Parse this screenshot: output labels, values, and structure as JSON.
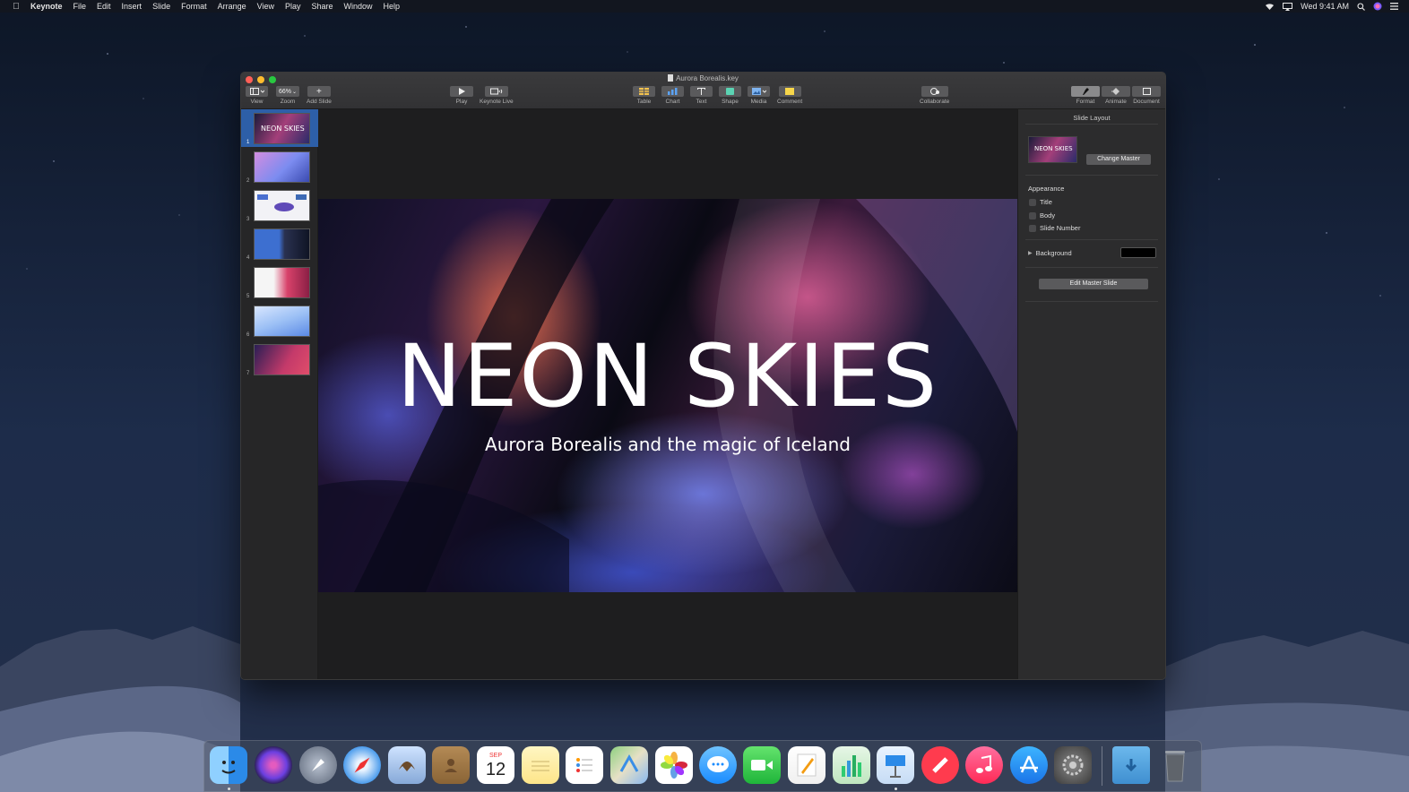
{
  "menubar": {
    "app": "Keynote",
    "items": [
      "File",
      "Edit",
      "Insert",
      "Slide",
      "Format",
      "Arrange",
      "View",
      "Play",
      "Share",
      "Window",
      "Help"
    ],
    "clock": "Wed 9:41 AM"
  },
  "window": {
    "title": "Aurora Borealis.key"
  },
  "toolbar": {
    "view_label": "View",
    "zoom_value": "66%",
    "zoom_label": "Zoom",
    "add_slide_label": "Add Slide",
    "play_label": "Play",
    "keynote_live_label": "Keynote Live",
    "table_label": "Table",
    "chart_label": "Chart",
    "text_label": "Text",
    "shape_label": "Shape",
    "media_label": "Media",
    "comment_label": "Comment",
    "collaborate_label": "Collaborate",
    "format_label": "Format",
    "animate_label": "Animate",
    "document_label": "Document"
  },
  "navigator": {
    "slides": [
      {
        "num": "1",
        "thumb_text": "NEON SKIES"
      },
      {
        "num": "2"
      },
      {
        "num": "3"
      },
      {
        "num": "4"
      },
      {
        "num": "5"
      },
      {
        "num": "6"
      },
      {
        "num": "7"
      }
    ],
    "selected": 0
  },
  "slide": {
    "title": "NEON SKIES",
    "subtitle": "Aurora Borealis and the magic of Iceland"
  },
  "inspector": {
    "header": "Slide Layout",
    "master_thumb_text": "NEON SKIES",
    "change_master": "Change Master",
    "appearance": "Appearance",
    "checkboxes": [
      "Title",
      "Body",
      "Slide Number"
    ],
    "background": "Background",
    "background_color": "#000000",
    "edit_master": "Edit Master Slide"
  },
  "dock": {
    "apps": [
      "finder-icon",
      "siri-icon",
      "launchpad-icon",
      "safari-icon",
      "mail-icon",
      "contacts-icon",
      "calendar-icon",
      "notes-icon",
      "reminders-icon",
      "maps-icon",
      "photos-icon",
      "messages-icon",
      "facetime-icon",
      "pages-icon",
      "numbers-icon",
      "keynote-icon",
      "news-icon",
      "music-icon",
      "app-store-icon",
      "system-preferences-icon",
      "downloads-folder-icon",
      "trash-icon"
    ],
    "calendar_month": "SEP",
    "calendar_day": "12"
  }
}
